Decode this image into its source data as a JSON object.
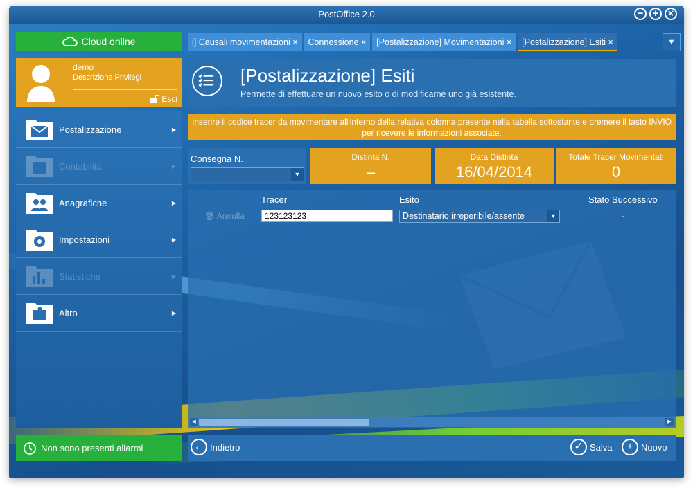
{
  "window": {
    "title": "PostOffice 2.0"
  },
  "sidebar": {
    "cloud_status": "Cloud online",
    "user": {
      "name": "demo",
      "privileges": "Descrizione Privilegi",
      "logout_label": "Esci"
    },
    "menu": [
      {
        "label": "Postalizzazione",
        "icon": "envelope-icon",
        "enabled": true
      },
      {
        "label": "Contabilità",
        "icon": "calculator-icon",
        "enabled": false
      },
      {
        "label": "Anagrafiche",
        "icon": "people-icon",
        "enabled": true
      },
      {
        "label": "Impostazioni",
        "icon": "gear-icon",
        "enabled": true
      },
      {
        "label": "Statistiche",
        "icon": "bar-chart-icon",
        "enabled": false
      },
      {
        "label": "Altro",
        "icon": "puzzle-icon",
        "enabled": true
      }
    ],
    "alarm_status": "Non sono presenti allarmi"
  },
  "tabs": [
    {
      "label": "i] Causali movimentazioni ×",
      "active": false
    },
    {
      "label": "Connessione ×",
      "active": false
    },
    {
      "label": "[Postalizzazione] Movimentazioni ×",
      "active": false
    },
    {
      "label": "[Postalizzazione] Esiti ×",
      "active": true
    }
  ],
  "page": {
    "title": "[Postalizzazione] Esiti",
    "subtitle": "Permette di effettuare un nuovo esito o di modificarne uno già esistente.",
    "notice": "Inserire il codice tracer da movimentare all'interno della relativa colonna presente nella tabella sottostante e premere il tasto INVIO per ricevere le informazioni associate."
  },
  "fields": {
    "consegna_label": "Consegna N.",
    "consegna_value": "",
    "distinta_label": "Distinta N.",
    "distinta_value": "–",
    "data_label": "Data Distinta",
    "data_value": "16/04/2014",
    "totale_label": "Totale Tracer Movimentati",
    "totale_value": "0"
  },
  "grid": {
    "columns": [
      "Tracer",
      "Esito",
      "Stato Successivo"
    ],
    "rows": [
      {
        "action": "Annulla",
        "tracer": "123123123",
        "esito": "Destinatario irreperibile/assente",
        "stato": "-"
      }
    ]
  },
  "footer": {
    "back_label": "Indietro",
    "save_label": "Salva",
    "new_label": "Nuovo"
  },
  "colors": {
    "green": "#27b13c",
    "orange": "#e3a321",
    "blue": "#2a6fb0"
  }
}
